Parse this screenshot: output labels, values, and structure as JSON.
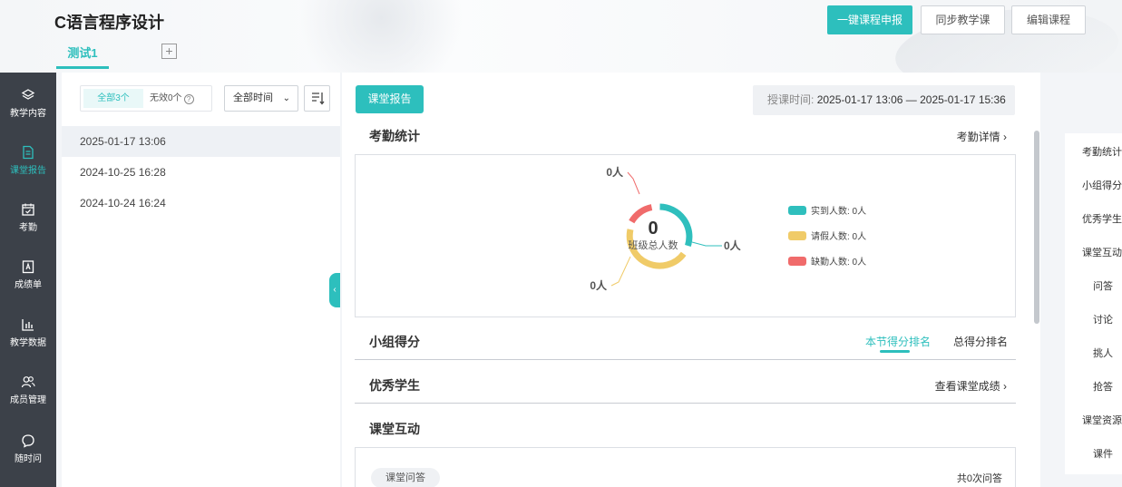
{
  "header": {
    "course_title": "C语言程序设计",
    "tab_active": "测试1",
    "tab_add": "+",
    "btn_report": "一键课程申报",
    "btn_sync": "同步教学课",
    "btn_edit": "编辑课程"
  },
  "sidebar": {
    "items": [
      {
        "label": "教学内容",
        "icon": "layers-icon"
      },
      {
        "label": "课堂报告",
        "icon": "document-icon"
      },
      {
        "label": "考勤",
        "icon": "calendar-check-icon"
      },
      {
        "label": "成绩单",
        "icon": "grade-sheet-icon"
      },
      {
        "label": "教学数据",
        "icon": "bar-chart-icon"
      },
      {
        "label": "成员管理",
        "icon": "members-icon"
      },
      {
        "label": "随时问",
        "icon": "chat-icon"
      }
    ],
    "active_index": 1
  },
  "list": {
    "filter_all": "全部3个",
    "filter_invalid": "无效0个",
    "time_select": "全部时间",
    "records": [
      "2025-01-17 13:06",
      "2024-10-25 16:28",
      "2024-10-24 16:24"
    ],
    "selected_index": 0
  },
  "main": {
    "report_btn": "课堂报告",
    "time_label": "授课时间:",
    "time_value": "2025-01-17 13:06 — 2025-01-17 15:36",
    "attendance": {
      "title": "考勤统计",
      "link": "考勤详情",
      "total_value": "0",
      "total_label": "班级总人数",
      "leader_top": "0人",
      "leader_right": "0人",
      "leader_bottom": "0人",
      "legend": [
        {
          "label": "实到人数: 0人",
          "color": "#2fbfbd"
        },
        {
          "label": "请假人数: 0人",
          "color": "#f0cb68"
        },
        {
          "label": "缺勤人数: 0人",
          "color": "#f06b6b"
        }
      ]
    },
    "group_score": {
      "title": "小组得分",
      "tab_current": "本节得分排名",
      "tab_total": "总得分排名"
    },
    "excellent": {
      "title": "优秀学生",
      "link": "查看课堂成绩"
    },
    "interaction": {
      "title": "课堂互动",
      "qa_pill": "课堂问答",
      "qa_count": "共0次问答"
    }
  },
  "right_nav": {
    "items": [
      "考勤统计",
      "小组得分",
      "优秀学生",
      "课堂互动",
      "问答",
      "讨论",
      "挑人",
      "抢答",
      "课堂资源",
      "课件"
    ]
  },
  "colors": {
    "accent": "#2dbfbd",
    "sidebar_bg": "#3c4149"
  }
}
